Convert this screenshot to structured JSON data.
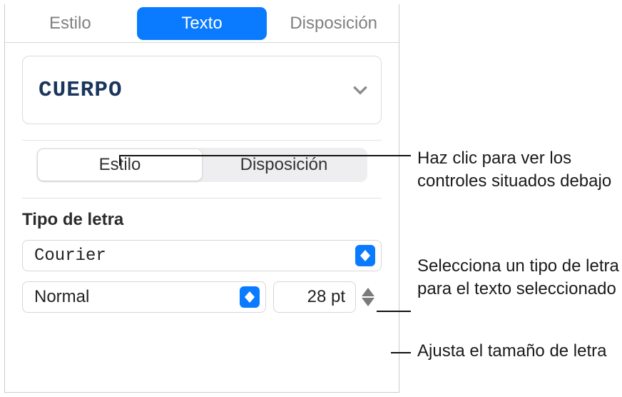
{
  "tabs": {
    "style": "Estilo",
    "text": "Texto",
    "layout": "Disposición"
  },
  "paragraph_style": {
    "value": "CUERPO"
  },
  "segmented": {
    "style": "Estilo",
    "layout": "Disposición"
  },
  "font": {
    "section_label": "Tipo de letra",
    "family": "Courier",
    "weight": "Normal",
    "size": "28 pt"
  },
  "callouts": {
    "style_segment": "Haz clic para ver los controles situados debajo",
    "font_family": "Selecciona un tipo de letra para el texto seleccionado",
    "size": "Ajusta el tamaño de letra"
  }
}
